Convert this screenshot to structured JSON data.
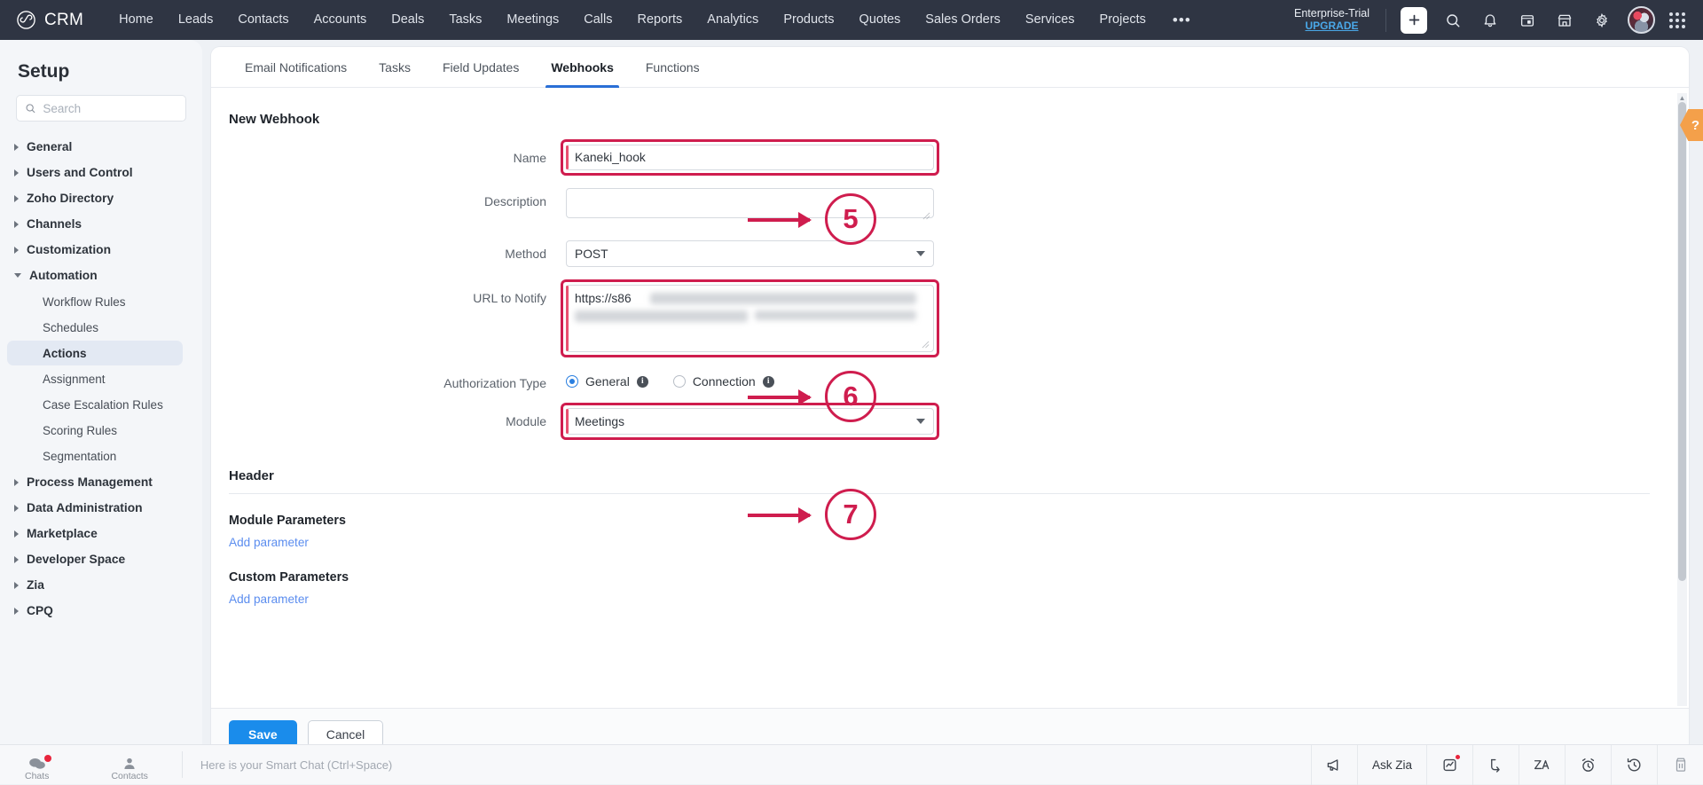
{
  "topnav": {
    "brand": "CRM",
    "items": [
      "Home",
      "Leads",
      "Contacts",
      "Accounts",
      "Deals",
      "Tasks",
      "Meetings",
      "Calls",
      "Reports",
      "Analytics",
      "Products",
      "Quotes",
      "Sales Orders",
      "Services",
      "Projects"
    ],
    "more": "•••",
    "trial_label": "Enterprise-Trial",
    "trial_upgrade": "UPGRADE",
    "icons": [
      "plus-icon",
      "search-icon",
      "bell-icon",
      "calendar-icon",
      "store-icon",
      "gear-icon",
      "avatar",
      "app-grid-icon"
    ]
  },
  "sidebar": {
    "title": "Setup",
    "search_placeholder": "Search",
    "search_value": "",
    "groups": [
      {
        "label": "General",
        "expanded": false
      },
      {
        "label": "Users and Control",
        "expanded": false
      },
      {
        "label": "Zoho Directory",
        "expanded": false
      },
      {
        "label": "Channels",
        "expanded": false
      },
      {
        "label": "Customization",
        "expanded": false
      },
      {
        "label": "Automation",
        "expanded": true,
        "children": [
          "Workflow Rules",
          "Schedules",
          "Actions",
          "Assignment",
          "Case Escalation Rules",
          "Scoring Rules",
          "Segmentation"
        ],
        "active_child": "Actions"
      },
      {
        "label": "Process Management",
        "expanded": false
      },
      {
        "label": "Data Administration",
        "expanded": false
      },
      {
        "label": "Marketplace",
        "expanded": false
      },
      {
        "label": "Developer Space",
        "expanded": false
      },
      {
        "label": "Zia",
        "expanded": false
      },
      {
        "label": "CPQ",
        "expanded": false
      }
    ]
  },
  "tabs": {
    "items": [
      "Email Notifications",
      "Tasks",
      "Field Updates",
      "Webhooks",
      "Functions"
    ],
    "active": "Webhooks"
  },
  "form": {
    "title": "New Webhook",
    "name": {
      "label": "Name",
      "value": "Kaneki_hook",
      "placeholder": ""
    },
    "description": {
      "label": "Description",
      "value": "",
      "placeholder": ""
    },
    "method": {
      "label": "Method",
      "value": "POST"
    },
    "url": {
      "label": "URL to Notify",
      "value": "https://s86"
    },
    "authorization": {
      "label": "Authorization Type",
      "options": [
        "General",
        "Connection"
      ],
      "selected": "General"
    },
    "module": {
      "label": "Module",
      "value": "Meetings"
    }
  },
  "header_section": {
    "title": "Header",
    "module_parameters_title": "Module Parameters",
    "module_add_parameter": "Add parameter",
    "custom_parameters_title": "Custom Parameters",
    "custom_add_parameter": "Add parameter"
  },
  "footer": {
    "save": "Save",
    "cancel": "Cancel"
  },
  "annotations": [
    {
      "number": "5",
      "target": "name-field"
    },
    {
      "number": "6",
      "target": "url-field"
    },
    {
      "number": "7",
      "target": "module-field"
    }
  ],
  "help_tab": {
    "glyph": "?"
  },
  "bottombar": {
    "chats": "Chats",
    "contacts": "Contacts",
    "smart_chat": "Here is your Smart Chat (Ctrl+Space)",
    "ask_zia": "Ask Zia",
    "icons": [
      "megaphone-icon",
      "chart-icon",
      "flow-icon",
      "zia-icon",
      "alarm-icon",
      "history-icon",
      "trash-icon"
    ]
  },
  "colors": {
    "annotation": "#cf1d4e",
    "accent_blue": "#1a8ceb",
    "nav_bg": "#2f3543",
    "link_blue": "#5b8def"
  }
}
